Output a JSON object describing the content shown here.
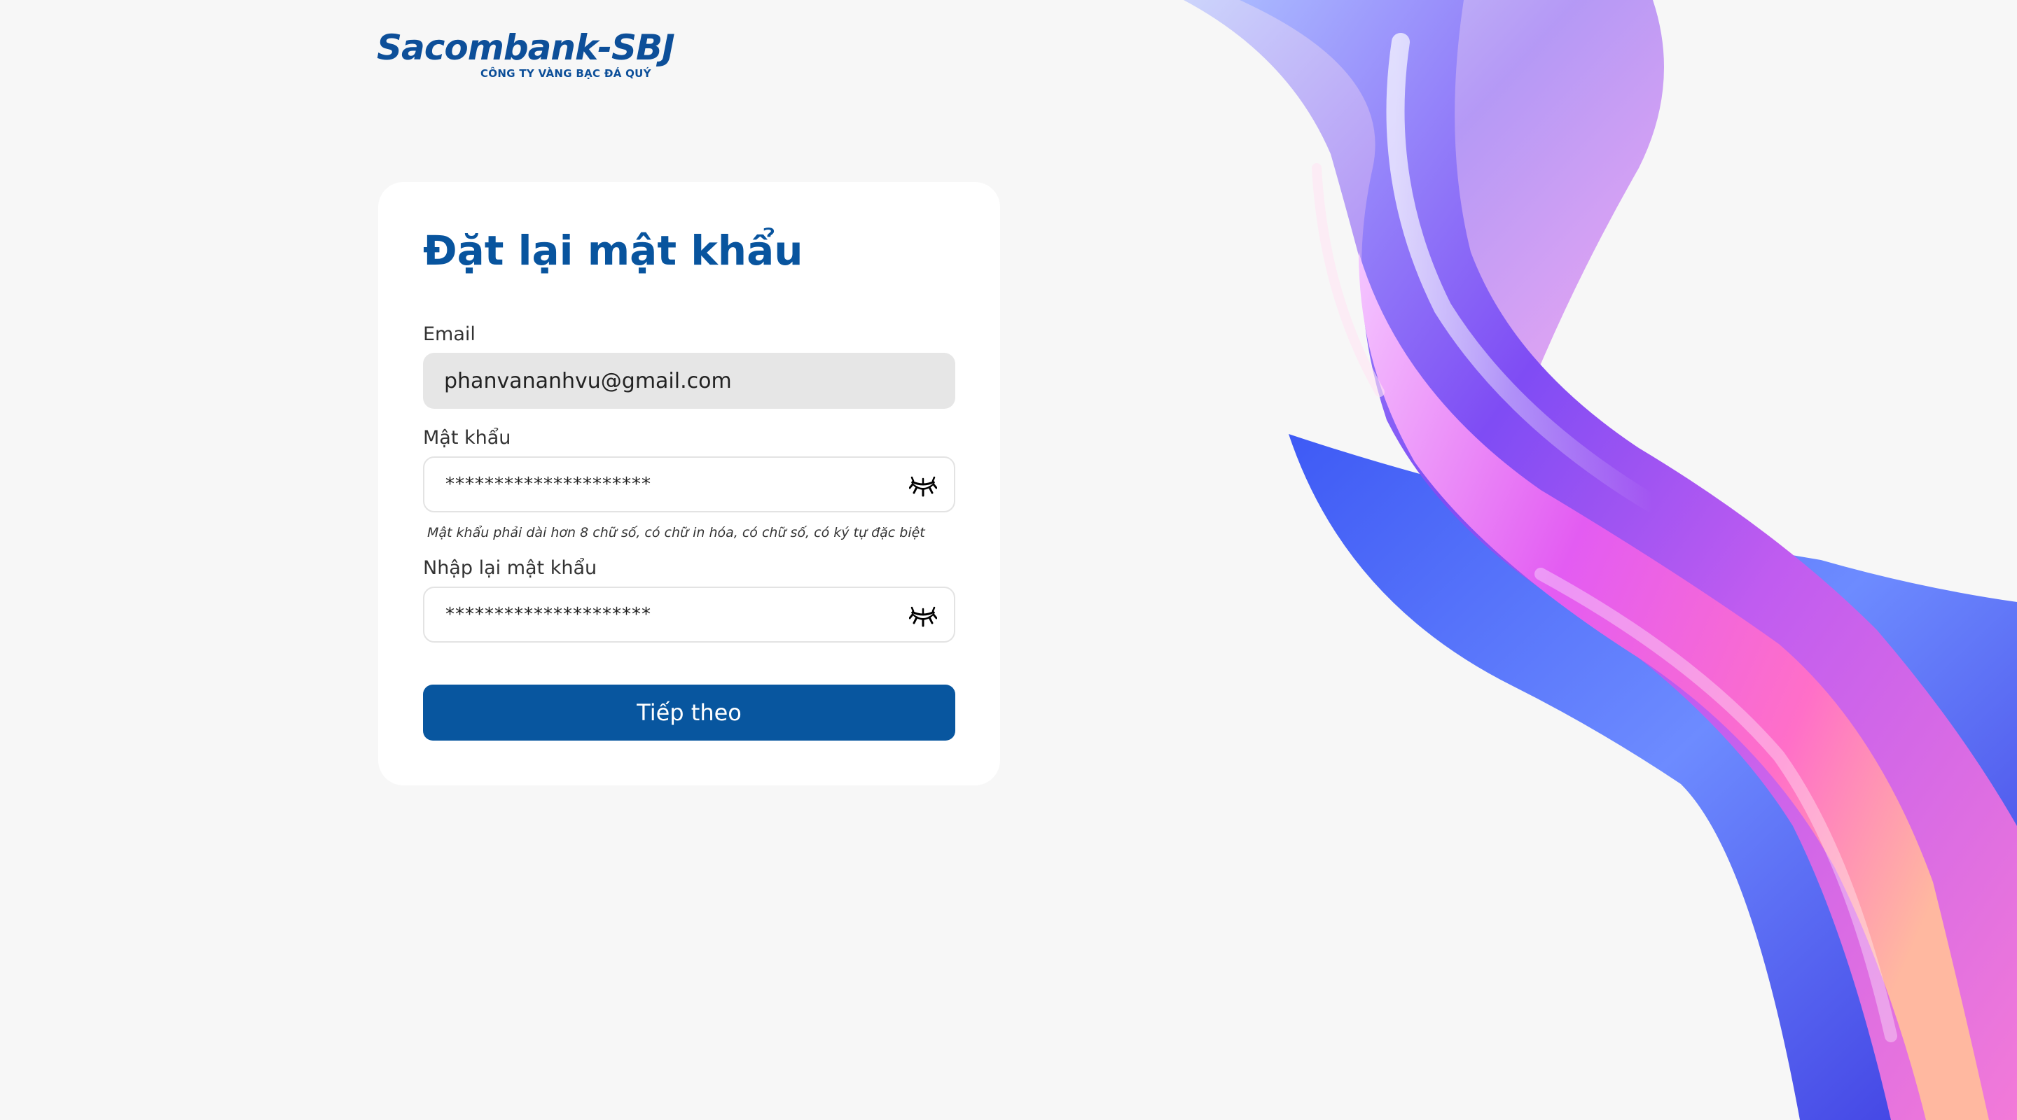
{
  "logo": {
    "brand": "Sacombank-SBJ",
    "tagline": "CÔNG TY VÀNG BẠC ĐÁ QUÝ"
  },
  "form": {
    "title": "Đặt lại mật khẩu",
    "email": {
      "label": "Email",
      "value": "phanvananhvu@gmail.com"
    },
    "password": {
      "label": "Mật khẩu",
      "value": "*********************",
      "hint": "Mật khẩu phải dài hơn 8 chữ số, có chữ in hóa, có chữ số, có ký tự đặc biệt",
      "toggle_icon": "eye-closed-icon"
    },
    "confirm_password": {
      "label": "Nhập lại mật khẩu",
      "value": "*********************",
      "toggle_icon": "eye-closed-icon"
    },
    "submit_label": "Tiếp theo"
  },
  "colors": {
    "primary": "#08569f",
    "background": "#f7f7f7",
    "card": "#ffffff",
    "email_field_bg": "#e6e6e6"
  }
}
